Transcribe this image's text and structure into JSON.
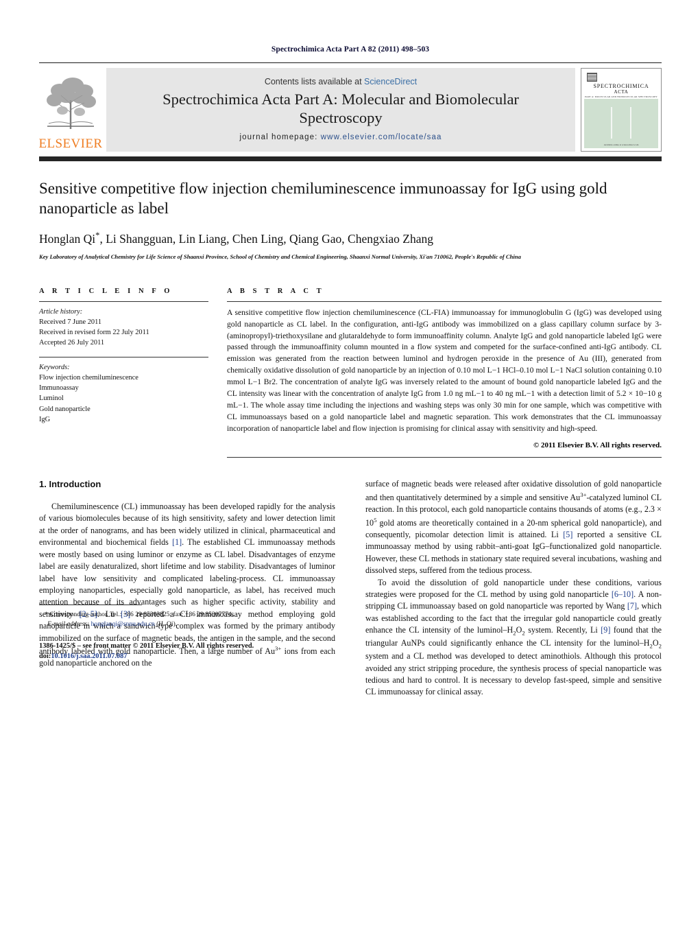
{
  "running_head": "Spectrochimica Acta Part A 82 (2011) 498–503",
  "masthead": {
    "contents_prefix": "Contents lists available at ",
    "sciencedirect": "ScienceDirect",
    "journal_title": "Spectrochimica Acta Part A: Molecular and Biomolecular Spectroscopy",
    "homepage_label": "journal homepage:",
    "homepage_url": "www.elsevier.com/locate/saa",
    "publisher": "ELSEVIER",
    "publisher_color": "#ef7d22",
    "link_color": "#3a6ea5",
    "cover": {
      "title_line1": "SPECTROCHIMICA",
      "title_line2": "ACTA",
      "subtitle": "PART A: MOLECULAR AND BIOMOLECULAR SPECTROSCOPY",
      "footer": "Available online at sciencedirect.com",
      "background": "#cfe0d0"
    }
  },
  "article": {
    "title": "Sensitive competitive flow injection chemiluminescence immunoassay for IgG using gold nanoparticle as label",
    "authors": "Honglan Qi*, Li Shangguan, Lin Liang, Chen Ling, Qiang Gao, Chengxiao Zhang",
    "affiliation": "Key Laboratory of Analytical Chemistry for Life Science of Shaanxi Province, School of Chemistry and Chemical Engineering, Shaanxi Normal University, Xi'an 710062, People's Republic of China"
  },
  "article_info": {
    "heading": "A R T I C L E   I N F O",
    "history_label": "Article history:",
    "history": [
      "Received 7 June 2011",
      "Received in revised form 22 July 2011",
      "Accepted 26 July 2011"
    ],
    "keywords_label": "Keywords:",
    "keywords": [
      "Flow injection chemiluminescence",
      "Immunoassay",
      "Luminol",
      "Gold nanoparticle",
      "IgG"
    ]
  },
  "abstract": {
    "heading": "A B S T R A C T",
    "text": "A sensitive competitive flow injection chemiluminescence (CL-FIA) immunoassay for immunoglobulin G (IgG) was developed using gold nanoparticle as CL label. In the configuration, anti-IgG antibody was immobilized on a glass capillary column surface by 3-(aminopropyl)-triethoxysilane and glutaraldehyde to form immunoaffinity column. Analyte IgG and gold nanoparticle labeled IgG were passed through the immunoaffinity column mounted in a flow system and competed for the surface-confined anti-IgG antibody. CL emission was generated from the reaction between luminol and hydrogen peroxide in the presence of Au (III), generated from chemically oxidative dissolution of gold nanoparticle by an injection of 0.10 mol L−1 HCl–0.10 mol L−1 NaCl solution containing 0.10 mmol L−1 Br2. The concentration of analyte IgG was inversely related to the amount of bound gold nanoparticle labeled IgG and the CL intensity was linear with the concentration of analyte IgG from 1.0 ng mL−1 to 40 ng mL−1 with a detection limit of 5.2 × 10−10 g mL−1. The whole assay time including the injections and washing steps was only 30 min for one sample, which was competitive with CL immunoassays based on a gold nanoparticle label and magnetic separation. This work demonstrates that the CL immunoassay incorporation of nanoparticle label and flow injection is promising for clinical assay with sensitivity and high-speed.",
    "copyright": "© 2011 Elsevier B.V. All rights reserved."
  },
  "introduction": {
    "heading": "1. Introduction",
    "left_paragraphs": [
      "Chemiluminescence (CL) immunoassay has been developed rapidly for the analysis of various biomolecules because of its high sensitivity, safety and lower detection limit at the order of nanograms, and has been widely utilized in clinical, pharmaceutical and environmental and biochemical fields [1]. The established CL immunoassay methods were mostly based on using luminor or enzyme as CL label. Disadvantages of enzyme label are easily denaturalized, short lifetime and low stability. Disadvantages of luminor label have low sensitivity and complicated labeling-process. CL immunoassay employing nanoparticles, especially gold nanoparticle, as label, has received much attention because of its advantages such as higher specific activity, stability and sensitivity [2–5]. Lu [3] reported a CL immunoassay method employing gold nanoparticle in which a sandwich-type complex was formed by the primary antibody immobilized on the surface of magnetic beads, the antigen in the sample, and the second antibody labeled with gold nanoparticle. Then, a large number of Au3+ ions from each gold nanoparticle anchored on the"
    ],
    "right_paragraphs": [
      "surface of magnetic beads were released after oxidative dissolution of gold nanoparticle and then quantitatively determined by a simple and sensitive Au3+-catalyzed luminol CL reaction. In this protocol, each gold nanoparticle contains thousands of atoms (e.g., 2.3 × 105 gold atoms are theoretically contained in a 20-nm spherical gold nanoparticle), and consequently, picomolar detection limit is attained. Li [5] reported a sensitive CL immunoassay method by using rabbit–anti-goat IgG–functionalized gold nanoparticle. However, these CL methods in stationary state required several incubations, washing and dissolved steps, suffered from the tedious process.",
      "To avoid the dissolution of gold nanoparticle under these conditions, various strategies were proposed for the CL method by using gold nanoparticle [6–10]. A non-stripping CL immunoassay based on gold nanoparticle was reported by Wang [7], which was established according to the fact that the irregular gold nanoparticle could greatly enhance the CL intensity of the luminol–H2O2 system. Recently, Li [9] found that the triangular AuNPs could significantly enhance the CL intensity for the luminol–H2O2 system and a CL method was developed to detect aminothiols. Although this protocol avoided any strict stripping procedure, the synthesis process of special nanoparticle was tedious and hard to control. It is necessary to develop fast-speed, simple and sensitive CL immunoassay for clinical assay."
    ],
    "reference_color": "#1f3e8c"
  },
  "footnotes": {
    "corresponding_marker": "*",
    "corresponding_text": "Corresponding author. Tel.: +86 29 85303825; fax: +86 29 85307774.",
    "email_label": "E-mail address:",
    "email": "honglanqi@snnu.edu.cn",
    "email_suffix": "(H. Qi).",
    "issn_line": "1386-1425/$ – see front matter © 2011 Elsevier B.V. All rights reserved.",
    "doi_label": "doi:",
    "doi_value": "10.1016/j.saa.2011.07.087"
  }
}
